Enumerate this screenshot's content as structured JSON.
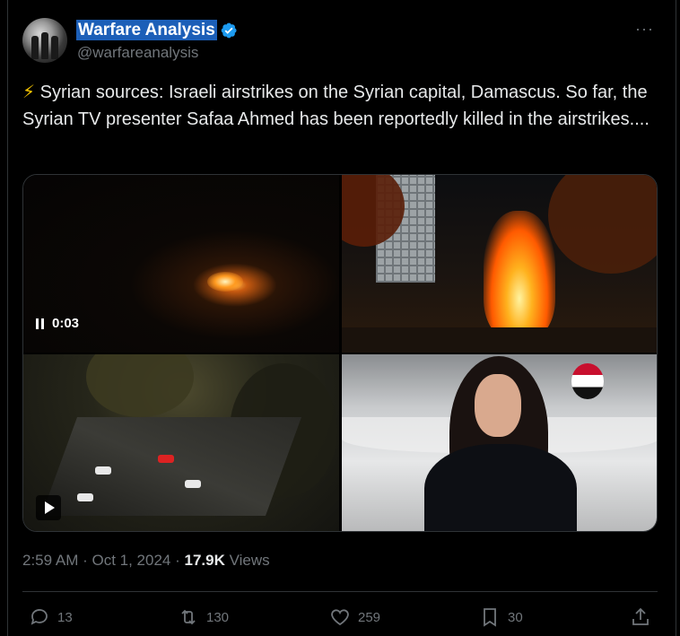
{
  "author": {
    "name": "Warfare Analysis",
    "handle": "@warfareanalysis",
    "verified": true
  },
  "more_label": "···",
  "tweet": {
    "emoji": "⚡",
    "text": "Syrian sources: Israeli airstrikes on the Syrian capital, Damascus. So far, the Syrian TV presenter Safaa Ahmed has been reportedly killed in the airstrikes...."
  },
  "media": {
    "video_time": "0:03",
    "tiles": [
      "video-night-fire",
      "photo-burning-building",
      "video-street-aerial",
      "photo-tv-presenter"
    ]
  },
  "meta": {
    "time": "2:59 AM",
    "separator": " · ",
    "date": "Oct 1, 2024",
    "views_count": "17.9K",
    "views_label": "Views"
  },
  "actions": {
    "replies": "13",
    "reposts": "130",
    "likes": "259",
    "bookmarks": "30"
  },
  "colors": {
    "background": "#000000",
    "text": "#e7e9ea",
    "muted": "#71767b",
    "verified": "#1d9bf0",
    "name_highlight": "#1c5fb8"
  }
}
